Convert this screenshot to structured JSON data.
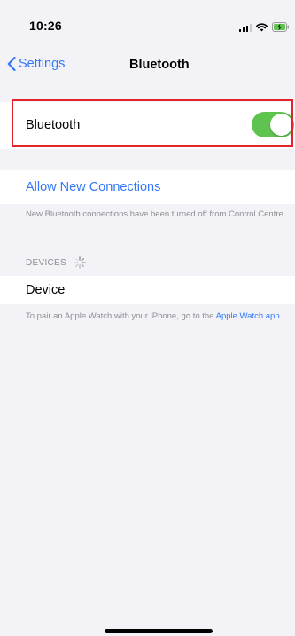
{
  "status_bar": {
    "time": "10:26",
    "icons": [
      "signal-icon",
      "wifi-icon",
      "battery-charging-icon"
    ]
  },
  "nav": {
    "back_label": "Settings",
    "title": "Bluetooth",
    "back_icon": "chevron-left-icon"
  },
  "bluetooth_row": {
    "label": "Bluetooth",
    "toggle_on": true,
    "toggle_color": "#5fc44f"
  },
  "allow_connections": {
    "label": "Allow New Connections",
    "note": "New Bluetooth connections have been turned off from Control Centre."
  },
  "devices": {
    "header": "DEVICES",
    "spinner_icon": "loading-spinner-icon",
    "items": [
      "Device"
    ]
  },
  "footer": {
    "text": "To pair an Apple Watch with your iPhone, go to the",
    "link": "Apple Watch app",
    "suffix": "."
  },
  "colors": {
    "accent": "#3478f6",
    "highlight": "#e3242b",
    "background": "#f2f2f7"
  }
}
